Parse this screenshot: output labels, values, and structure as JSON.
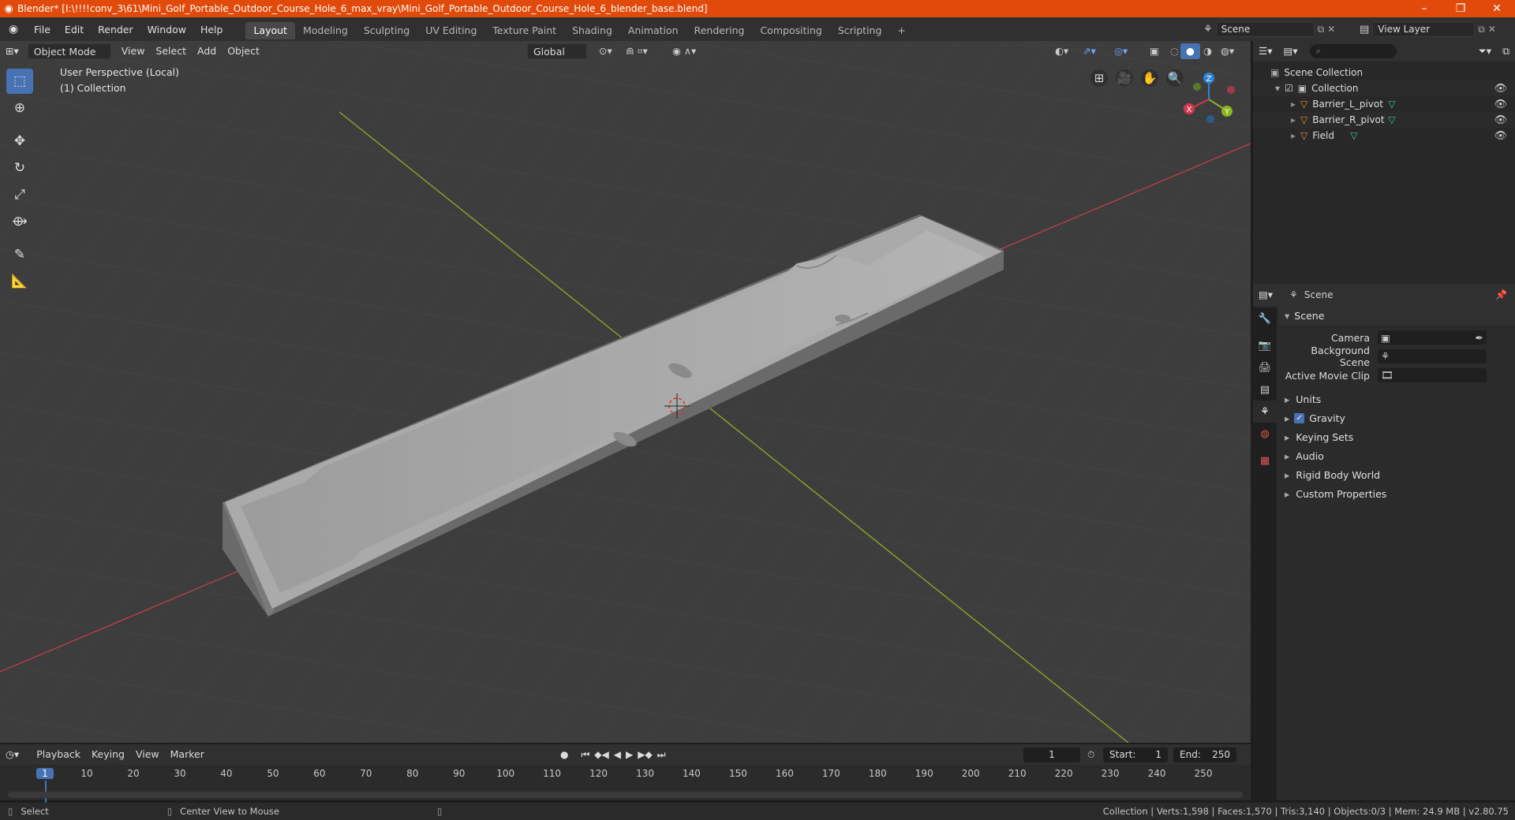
{
  "window": {
    "title": "Blender* [I:\\!!!!conv_3\\61\\Mini_Golf_Portable_Outdoor_Course_Hole_6_max_vray\\Mini_Golf_Portable_Outdoor_Course_Hole_6_blender_base.blend]",
    "minimize": "–",
    "maximize": "❐",
    "close": "✕"
  },
  "menu": [
    "File",
    "Edit",
    "Render",
    "Window",
    "Help"
  ],
  "workspaces": [
    "Layout",
    "Modeling",
    "Sculpting",
    "UV Editing",
    "Texture Paint",
    "Shading",
    "Animation",
    "Rendering",
    "Compositing",
    "Scripting"
  ],
  "workspace_add": "+",
  "scene_name": "Scene",
  "view_layer": "View Layer",
  "viewport": {
    "mode": "Object Mode",
    "menus": [
      "View",
      "Select",
      "Add",
      "Object"
    ],
    "transform_orientation": "Global",
    "overlay_line1": "User Perspective (Local)",
    "overlay_line2": "(1) Collection",
    "axis_labels": {
      "x": "X",
      "y": "Y",
      "z": "Z"
    }
  },
  "outliner": {
    "root": "Scene Collection",
    "collection": "Collection",
    "items": [
      "Barrier_L_pivot",
      "Barrier_R_pivot",
      "Field"
    ]
  },
  "properties": {
    "context": "Scene",
    "section": "Scene",
    "fields": [
      "Camera",
      "Background Scene",
      "Active Movie Clip"
    ],
    "panels": [
      "Units",
      "Gravity",
      "Keying Sets",
      "Audio",
      "Rigid Body World",
      "Custom Properties"
    ],
    "gravity_checked": true
  },
  "timeline": {
    "menus": [
      "Playback",
      "Keying",
      "View",
      "Marker"
    ],
    "current_frame": "1",
    "start_label": "Start:",
    "start": "1",
    "end_label": "End:",
    "end": "250",
    "ticks": [
      "1",
      "10",
      "20",
      "30",
      "40",
      "50",
      "60",
      "70",
      "80",
      "90",
      "100",
      "110",
      "120",
      "130",
      "140",
      "150",
      "160",
      "170",
      "180",
      "190",
      "200",
      "210",
      "220",
      "230",
      "240",
      "250"
    ]
  },
  "status": {
    "left1": "Select",
    "left2": "Center View to Mouse",
    "right": "Collection | Verts:1,598 | Faces:1,570 | Tris:3,140 | Objects:0/3 | Mem: 24.9 MB | v2.80.75"
  },
  "colors": {
    "title_bar": "#e24a0b",
    "accent": "#4772b3",
    "x_axis": "#d33a4e",
    "y_axis": "#8bb521",
    "z_axis": "#2f83d7"
  }
}
